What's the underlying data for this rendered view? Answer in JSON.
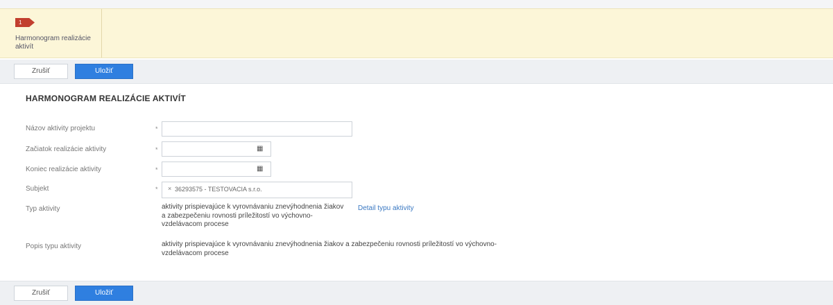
{
  "wizard": {
    "step_number": "1",
    "step_label": "Harmonogram realizácie aktivít"
  },
  "toolbar": {
    "cancel_label": "Zrušiť",
    "save_label": "Uložiť"
  },
  "form": {
    "title": "HARMONOGRAM REALIZÁCIE AKTIVÍT",
    "required_marker": "*",
    "fields": {
      "name_label": "Názov aktivity projektu",
      "name_value": "",
      "start_label": "Začiatok realizácie aktivity",
      "start_value": "",
      "end_label": "Koniec realizácie aktivity",
      "end_value": "",
      "subject_label": "Subjekt",
      "subject_tag": "36293575 - TESTOVACIA s.r.o.",
      "type_label": "Typ aktivity",
      "type_value": "aktivity prispievajúce k vyrovnávaniu znevýhodnenia žiakov a zabezpečeniu rovnosti príležitostí vo výchovno-vzdelávacom procese",
      "type_detail_link": "Detail typu aktivity",
      "desc_label": "Popis typu aktivity",
      "desc_value": "aktivity prispievajúce k vyrovnávaniu znevýhodnenia žiakov a zabezpečeniu rovnosti príležitostí vo výchovno-vzdelávacom procese"
    }
  },
  "icons": {
    "calendar": "calendar-icon",
    "remove": "remove-tag-icon",
    "step": "step-arrow-icon"
  },
  "colors": {
    "wizard_bg": "#fcf6d8",
    "step_marker": "#c23f2f",
    "primary_button": "#2f7fe0",
    "link": "#3a78c2"
  }
}
